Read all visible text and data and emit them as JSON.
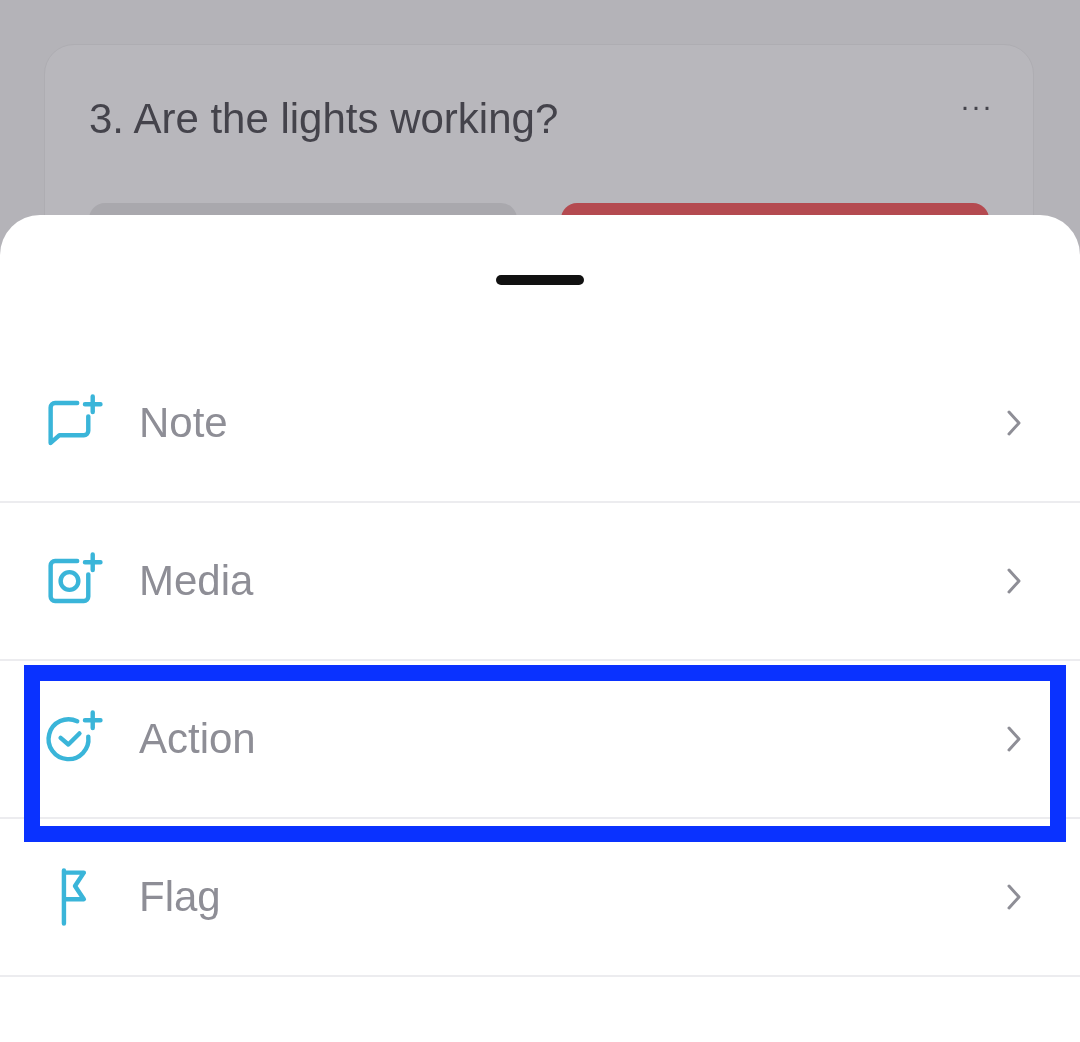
{
  "question_card": {
    "title": "3. Are the lights working?",
    "menu": "···",
    "answer_buttons": [
      {
        "color": "#a9a8ad"
      },
      {
        "color": "#b44a50"
      }
    ]
  },
  "sheet": {
    "items": [
      {
        "kind": "note",
        "label": "Note",
        "highlighted": false
      },
      {
        "kind": "media",
        "label": "Media",
        "highlighted": false
      },
      {
        "kind": "action",
        "label": "Action",
        "highlighted": true
      },
      {
        "kind": "flag",
        "label": "Flag",
        "highlighted": false
      }
    ]
  }
}
